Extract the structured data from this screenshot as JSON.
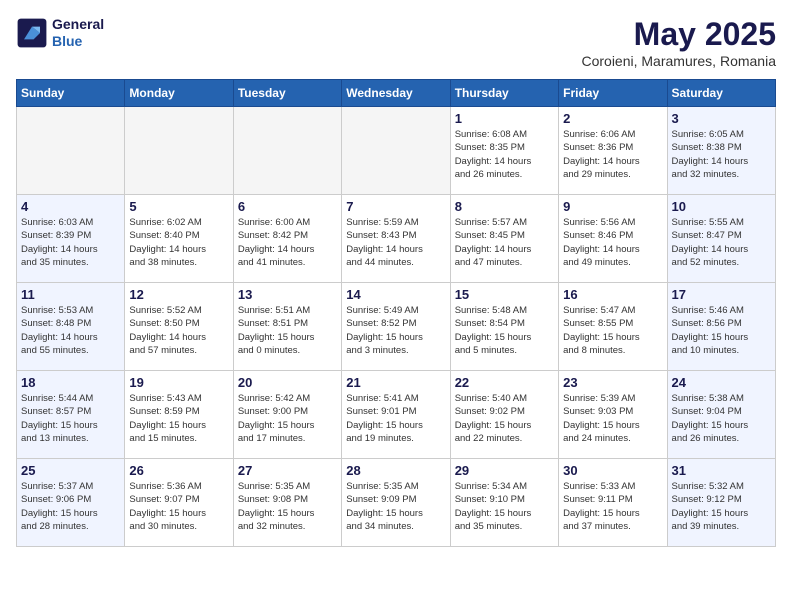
{
  "header": {
    "logo_line1": "General",
    "logo_line2": "Blue",
    "month_title": "May 2025",
    "subtitle": "Coroieni, Maramures, Romania"
  },
  "weekdays": [
    "Sunday",
    "Monday",
    "Tuesday",
    "Wednesday",
    "Thursday",
    "Friday",
    "Saturday"
  ],
  "weeks": [
    [
      {
        "day": "",
        "info": "",
        "empty": true
      },
      {
        "day": "",
        "info": "",
        "empty": true
      },
      {
        "day": "",
        "info": "",
        "empty": true
      },
      {
        "day": "",
        "info": "",
        "empty": true
      },
      {
        "day": "1",
        "info": "Sunrise: 6:08 AM\nSunset: 8:35 PM\nDaylight: 14 hours\nand 26 minutes.",
        "empty": false,
        "weekend": false
      },
      {
        "day": "2",
        "info": "Sunrise: 6:06 AM\nSunset: 8:36 PM\nDaylight: 14 hours\nand 29 minutes.",
        "empty": false,
        "weekend": false
      },
      {
        "day": "3",
        "info": "Sunrise: 6:05 AM\nSunset: 8:38 PM\nDaylight: 14 hours\nand 32 minutes.",
        "empty": false,
        "weekend": true
      }
    ],
    [
      {
        "day": "4",
        "info": "Sunrise: 6:03 AM\nSunset: 8:39 PM\nDaylight: 14 hours\nand 35 minutes.",
        "empty": false,
        "weekend": true
      },
      {
        "day": "5",
        "info": "Sunrise: 6:02 AM\nSunset: 8:40 PM\nDaylight: 14 hours\nand 38 minutes.",
        "empty": false,
        "weekend": false
      },
      {
        "day": "6",
        "info": "Sunrise: 6:00 AM\nSunset: 8:42 PM\nDaylight: 14 hours\nand 41 minutes.",
        "empty": false,
        "weekend": false
      },
      {
        "day": "7",
        "info": "Sunrise: 5:59 AM\nSunset: 8:43 PM\nDaylight: 14 hours\nand 44 minutes.",
        "empty": false,
        "weekend": false
      },
      {
        "day": "8",
        "info": "Sunrise: 5:57 AM\nSunset: 8:45 PM\nDaylight: 14 hours\nand 47 minutes.",
        "empty": false,
        "weekend": false
      },
      {
        "day": "9",
        "info": "Sunrise: 5:56 AM\nSunset: 8:46 PM\nDaylight: 14 hours\nand 49 minutes.",
        "empty": false,
        "weekend": false
      },
      {
        "day": "10",
        "info": "Sunrise: 5:55 AM\nSunset: 8:47 PM\nDaylight: 14 hours\nand 52 minutes.",
        "empty": false,
        "weekend": true
      }
    ],
    [
      {
        "day": "11",
        "info": "Sunrise: 5:53 AM\nSunset: 8:48 PM\nDaylight: 14 hours\nand 55 minutes.",
        "empty": false,
        "weekend": true
      },
      {
        "day": "12",
        "info": "Sunrise: 5:52 AM\nSunset: 8:50 PM\nDaylight: 14 hours\nand 57 minutes.",
        "empty": false,
        "weekend": false
      },
      {
        "day": "13",
        "info": "Sunrise: 5:51 AM\nSunset: 8:51 PM\nDaylight: 15 hours\nand 0 minutes.",
        "empty": false,
        "weekend": false
      },
      {
        "day": "14",
        "info": "Sunrise: 5:49 AM\nSunset: 8:52 PM\nDaylight: 15 hours\nand 3 minutes.",
        "empty": false,
        "weekend": false
      },
      {
        "day": "15",
        "info": "Sunrise: 5:48 AM\nSunset: 8:54 PM\nDaylight: 15 hours\nand 5 minutes.",
        "empty": false,
        "weekend": false
      },
      {
        "day": "16",
        "info": "Sunrise: 5:47 AM\nSunset: 8:55 PM\nDaylight: 15 hours\nand 8 minutes.",
        "empty": false,
        "weekend": false
      },
      {
        "day": "17",
        "info": "Sunrise: 5:46 AM\nSunset: 8:56 PM\nDaylight: 15 hours\nand 10 minutes.",
        "empty": false,
        "weekend": true
      }
    ],
    [
      {
        "day": "18",
        "info": "Sunrise: 5:44 AM\nSunset: 8:57 PM\nDaylight: 15 hours\nand 13 minutes.",
        "empty": false,
        "weekend": true
      },
      {
        "day": "19",
        "info": "Sunrise: 5:43 AM\nSunset: 8:59 PM\nDaylight: 15 hours\nand 15 minutes.",
        "empty": false,
        "weekend": false
      },
      {
        "day": "20",
        "info": "Sunrise: 5:42 AM\nSunset: 9:00 PM\nDaylight: 15 hours\nand 17 minutes.",
        "empty": false,
        "weekend": false
      },
      {
        "day": "21",
        "info": "Sunrise: 5:41 AM\nSunset: 9:01 PM\nDaylight: 15 hours\nand 19 minutes.",
        "empty": false,
        "weekend": false
      },
      {
        "day": "22",
        "info": "Sunrise: 5:40 AM\nSunset: 9:02 PM\nDaylight: 15 hours\nand 22 minutes.",
        "empty": false,
        "weekend": false
      },
      {
        "day": "23",
        "info": "Sunrise: 5:39 AM\nSunset: 9:03 PM\nDaylight: 15 hours\nand 24 minutes.",
        "empty": false,
        "weekend": false
      },
      {
        "day": "24",
        "info": "Sunrise: 5:38 AM\nSunset: 9:04 PM\nDaylight: 15 hours\nand 26 minutes.",
        "empty": false,
        "weekend": true
      }
    ],
    [
      {
        "day": "25",
        "info": "Sunrise: 5:37 AM\nSunset: 9:06 PM\nDaylight: 15 hours\nand 28 minutes.",
        "empty": false,
        "weekend": true
      },
      {
        "day": "26",
        "info": "Sunrise: 5:36 AM\nSunset: 9:07 PM\nDaylight: 15 hours\nand 30 minutes.",
        "empty": false,
        "weekend": false
      },
      {
        "day": "27",
        "info": "Sunrise: 5:35 AM\nSunset: 9:08 PM\nDaylight: 15 hours\nand 32 minutes.",
        "empty": false,
        "weekend": false
      },
      {
        "day": "28",
        "info": "Sunrise: 5:35 AM\nSunset: 9:09 PM\nDaylight: 15 hours\nand 34 minutes.",
        "empty": false,
        "weekend": false
      },
      {
        "day": "29",
        "info": "Sunrise: 5:34 AM\nSunset: 9:10 PM\nDaylight: 15 hours\nand 35 minutes.",
        "empty": false,
        "weekend": false
      },
      {
        "day": "30",
        "info": "Sunrise: 5:33 AM\nSunset: 9:11 PM\nDaylight: 15 hours\nand 37 minutes.",
        "empty": false,
        "weekend": false
      },
      {
        "day": "31",
        "info": "Sunrise: 5:32 AM\nSunset: 9:12 PM\nDaylight: 15 hours\nand 39 minutes.",
        "empty": false,
        "weekend": true
      }
    ]
  ]
}
